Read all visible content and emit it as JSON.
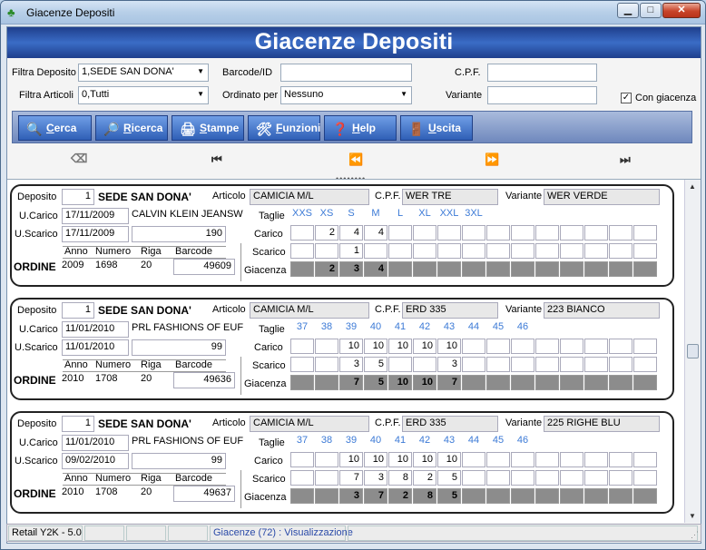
{
  "window": {
    "title": "Giacenze Depositi",
    "min": "▁",
    "max": "□",
    "close": "✕"
  },
  "header": {
    "title": "Giacenze Depositi"
  },
  "filters": {
    "filtra_deposito_label": "Filtra Deposito",
    "filtra_deposito_value": "1,SEDE SAN DONA'",
    "filtra_articoli_label": "Filtra Articoli",
    "filtra_articoli_value": "0,Tutti",
    "barcode_label": "Barcode/ID",
    "barcode_value": "",
    "ordinato_label": "Ordinato per",
    "ordinato_value": "Nessuno",
    "cpf_label": "C.P.F.",
    "cpf_value": "",
    "variante_label": "Variante",
    "variante_value": "",
    "con_giacenza_label": "Con giacenza",
    "con_giacenza_checked": "✓"
  },
  "toolbar": {
    "cerca": {
      "first": "C",
      "rest": "erca"
    },
    "ricerca": {
      "first": "R",
      "rest": "icerca"
    },
    "stampe": {
      "first": "S",
      "rest": "tampe"
    },
    "funzioni": {
      "first": "F",
      "rest": "unzioni"
    },
    "help": {
      "first": "H",
      "rest": "elp"
    },
    "uscita": {
      "first": "U",
      "rest": "scita"
    }
  },
  "nav": {
    "first": "⏮",
    "prev_page": "⏪",
    "next_page": "⏩",
    "last": "⏭"
  },
  "labels": {
    "deposito": "Deposito",
    "articolo": "Articolo",
    "cpf": "C.P.F.",
    "variante": "Variante",
    "ucarico": "U.Carico",
    "uscarico": "U.Scarico",
    "taglie": "Taglie",
    "carico": "Carico",
    "scarico": "Scarico",
    "giacenza": "Giacenza",
    "anno": "Anno",
    "numero": "Numero",
    "riga": "Riga",
    "barcode": "Barcode",
    "ordine": "ORDINE"
  },
  "records": [
    {
      "dep_num": "1",
      "dep_name": "SEDE SAN DONA'",
      "articolo": "CAMICIA M/L",
      "cpf": "WER TRE",
      "variante": "WER VERDE",
      "ucarico": "17/11/2009",
      "uscarico": "17/11/2009",
      "fornitore": "CALVIN KLEIN JEANSW",
      "qty": "190",
      "anno": "2009",
      "numero": "1698",
      "riga": "20",
      "barcode": "49609",
      "sizes": [
        "XXS",
        "XS",
        "S",
        "M",
        "L",
        "XL",
        "XXL",
        "3XL",
        "",
        "",
        "",
        "",
        "",
        "",
        "",
        ""
      ],
      "carico": [
        "",
        "2",
        "4",
        "4",
        "",
        "",
        "",
        "",
        "",
        "",
        "",
        "",
        "",
        "",
        "",
        ""
      ],
      "scarico": [
        "",
        "",
        "1",
        "",
        "",
        "",
        "",
        "",
        "",
        "",
        "",
        "",
        "",
        "",
        "",
        ""
      ],
      "giacenza": [
        "",
        "2",
        "3",
        "4",
        "",
        "",
        "",
        "",
        "",
        "",
        "",
        "",
        "",
        "",
        "",
        ""
      ]
    },
    {
      "dep_num": "1",
      "dep_name": "SEDE SAN DONA'",
      "articolo": "CAMICIA M/L",
      "cpf": "ERD 335",
      "variante": "223 BIANCO",
      "ucarico": "11/01/2010",
      "uscarico": "11/01/2010",
      "fornitore": "PRL FASHIONS OF EUF",
      "qty": "99",
      "anno": "2010",
      "numero": "1708",
      "riga": "20",
      "barcode": "49636",
      "sizes": [
        "37",
        "38",
        "39",
        "40",
        "41",
        "42",
        "43",
        "44",
        "45",
        "46",
        "",
        "",
        "",
        "",
        "",
        ""
      ],
      "carico": [
        "",
        "",
        "10",
        "10",
        "10",
        "10",
        "10",
        "",
        "",
        "",
        "",
        "",
        "",
        "",
        "",
        ""
      ],
      "scarico": [
        "",
        "",
        "3",
        "5",
        "",
        "",
        "3",
        "",
        "",
        "",
        "",
        "",
        "",
        "",
        "",
        ""
      ],
      "giacenza": [
        "",
        "",
        "7",
        "5",
        "10",
        "10",
        "7",
        "",
        "",
        "",
        "",
        "",
        "",
        "",
        "",
        ""
      ]
    },
    {
      "dep_num": "1",
      "dep_name": "SEDE SAN DONA'",
      "articolo": "CAMICIA M/L",
      "cpf": "ERD 335",
      "variante": "225 RIGHE BLU",
      "ucarico": "11/01/2010",
      "uscarico": "09/02/2010",
      "fornitore": "PRL FASHIONS OF EUF",
      "qty": "99",
      "anno": "2010",
      "numero": "1708",
      "riga": "20",
      "barcode": "49637",
      "sizes": [
        "37",
        "38",
        "39",
        "40",
        "41",
        "42",
        "43",
        "44",
        "45",
        "46",
        "",
        "",
        "",
        "",
        "",
        ""
      ],
      "carico": [
        "",
        "",
        "10",
        "10",
        "10",
        "10",
        "10",
        "",
        "",
        "",
        "",
        "",
        "",
        "",
        "",
        ""
      ],
      "scarico": [
        "",
        "",
        "7",
        "3",
        "8",
        "2",
        "5",
        "",
        "",
        "",
        "",
        "",
        "",
        "",
        "",
        ""
      ],
      "giacenza": [
        "",
        "",
        "3",
        "7",
        "2",
        "8",
        "5",
        "",
        "",
        "",
        "",
        "",
        "",
        "",
        "",
        ""
      ]
    }
  ],
  "status": {
    "app": "Retail Y2K - 5.0",
    "p2": "",
    "p3": "",
    "p4": "",
    "info": "Giacenze (72) : Visualizzazione",
    "p6": ""
  }
}
